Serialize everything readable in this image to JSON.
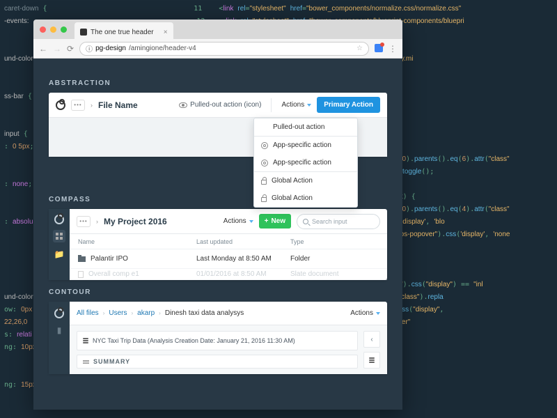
{
  "browser": {
    "tab_title": "The one true header",
    "url_host": "pg-design",
    "url_path": "/amingione/header-v4"
  },
  "sections": {
    "abstraction": {
      "title": "ABSTRACTION",
      "file_name": "File Name",
      "pulled_out_label": "Pulled-out action (icon)",
      "actions_label": "Actions",
      "primary_label": "Primary Action",
      "dropdown": {
        "items": [
          {
            "label": "Pulled-out action",
            "icon": null
          },
          {
            "label": "App-specific action",
            "icon": "gear"
          },
          {
            "label": "App-specific action",
            "icon": "gear"
          },
          {
            "label": "Global Action",
            "icon": "lock"
          },
          {
            "label": "Global Action",
            "icon": "lock"
          }
        ]
      }
    },
    "compass": {
      "title": "COMPASS",
      "project": "My Project 2016",
      "actions_label": "Actions",
      "new_label": "New",
      "search_placeholder": "Search input",
      "columns": {
        "name": "Name",
        "updated": "Last updated",
        "type": "Type"
      },
      "rows": [
        {
          "name": "Palantir IPO",
          "updated": "Last Monday at 8:50 AM",
          "type": "Folder",
          "icon": "folder"
        },
        {
          "name": "Overall comp e1",
          "updated": "01/01/2016 at 8:50 AM",
          "type": "Slate document",
          "icon": "doc",
          "dim": true
        }
      ]
    },
    "contour": {
      "title": "CONTOUR",
      "crumbs": [
        "All files",
        "Users",
        "akarp",
        "Dinesh taxi data analysys"
      ],
      "actions_label": "Actions",
      "card_label": "NYC Taxi Trip Data (Analysis Creation Date: January 21, 2016 11:30 AM)",
      "summary_label": "SUMMARY"
    }
  }
}
